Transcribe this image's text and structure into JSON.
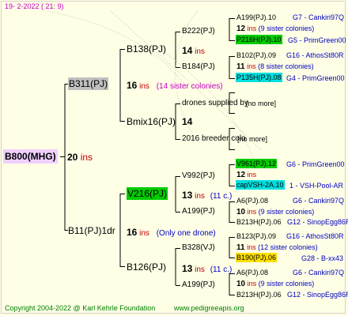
{
  "header": {
    "date": "19-  2-2022 (  21:   9)"
  },
  "footer": {
    "copyright": "Copyright 2004-2022 @ Karl Kehrle Foundation",
    "site": "www.pedigreeapis.org"
  },
  "root": {
    "name": "B800(MHG)",
    "num": "20",
    "ins": "ins"
  },
  "gen1": [
    {
      "name": "B311(PJ)",
      "num": "16",
      "ins": "ins",
      "note": "(14 sister colonies)"
    },
    {
      "name": "B11(PJ)1dr",
      "num": "16",
      "ins": "ins",
      "note": "(Only one drone)"
    }
  ],
  "gen2": [
    {
      "name": "B138(PJ)",
      "num": "14",
      "ins": "ins"
    },
    {
      "name": "Bmix16(PJ)",
      "num": "14"
    },
    {
      "name": "V216(PJ)",
      "num": "13",
      "ins": "ins",
      "note": "(11 c.)"
    },
    {
      "name": "B126(PJ)",
      "num": "13",
      "ins": "ins",
      "note": "(11 c.)"
    }
  ],
  "gen3": [
    {
      "name": "B222(PJ)"
    },
    {
      "name": "B184(PJ)"
    },
    {
      "name": "drones supplied by"
    },
    {
      "name": "2016 breeder colo"
    },
    {
      "name": "V992(PJ)"
    },
    {
      "name": "A199(PJ)"
    },
    {
      "name": "B328(VJ)"
    },
    {
      "name": "A199(PJ)"
    }
  ],
  "gen4": [
    {
      "name": "A199(PJ).10",
      "right": "G7 - Cankiri97Q"
    },
    {
      "num": "12",
      "ins": "ins",
      "note": "(9 sister colonies)"
    },
    {
      "name": "P216H(PJ).10",
      "right": "G5 - PrimGreen00"
    },
    {
      "name": "B102(PJ).09",
      "right": "G16 - AthosSt80R"
    },
    {
      "num": "11",
      "ins": "ins",
      "note": "(8 sister colonies)"
    },
    {
      "name": "P135H(PJ).08",
      "right": "G4 - PrimGreen00"
    },
    {
      "name": "[no more]"
    },
    {
      "name": "[no more]"
    },
    {
      "name": "V961(PJ).12",
      "right": "G6 - PrimGreen00"
    },
    {
      "num": "12",
      "ins": "ins"
    },
    {
      "name": "capVSH-2A.10",
      "right": "1 - VSH-Pool-AR"
    },
    {
      "name": "A6(PJ).08",
      "right": "G6 - Cankiri97Q"
    },
    {
      "num": "10",
      "ins": "ins",
      "note": "(9 sister colonies)"
    },
    {
      "name": "B213H(PJ).06",
      "right": "G12 - SinopEgg86R"
    },
    {
      "name": "B123(PJ).09",
      "right": "G16 - AthosSt80R"
    },
    {
      "num": "11",
      "ins": "ins",
      "note": "(12 sister colonies)"
    },
    {
      "name": "B190(PJ).06",
      "right": "G28 - B-xx43"
    },
    {
      "name": "A6(PJ).08",
      "right": "G6 - Cankiri97Q"
    },
    {
      "num": "10",
      "ins": "ins",
      "note": "(9 sister colonies)"
    },
    {
      "name": "B213H(PJ).06",
      "right": "G12 - SinopEgg86R"
    }
  ],
  "colors": {
    "background": "#ffffe6",
    "root_highlight": "#f0d0ff",
    "green_highlight": "#00cc00",
    "cyan_highlight": "#00e0e0",
    "yellow_highlight": "#ffe000",
    "grey_highlight": "#c0c0c0",
    "ins_red": "#c00000",
    "note_blue": "#0000c0"
  }
}
